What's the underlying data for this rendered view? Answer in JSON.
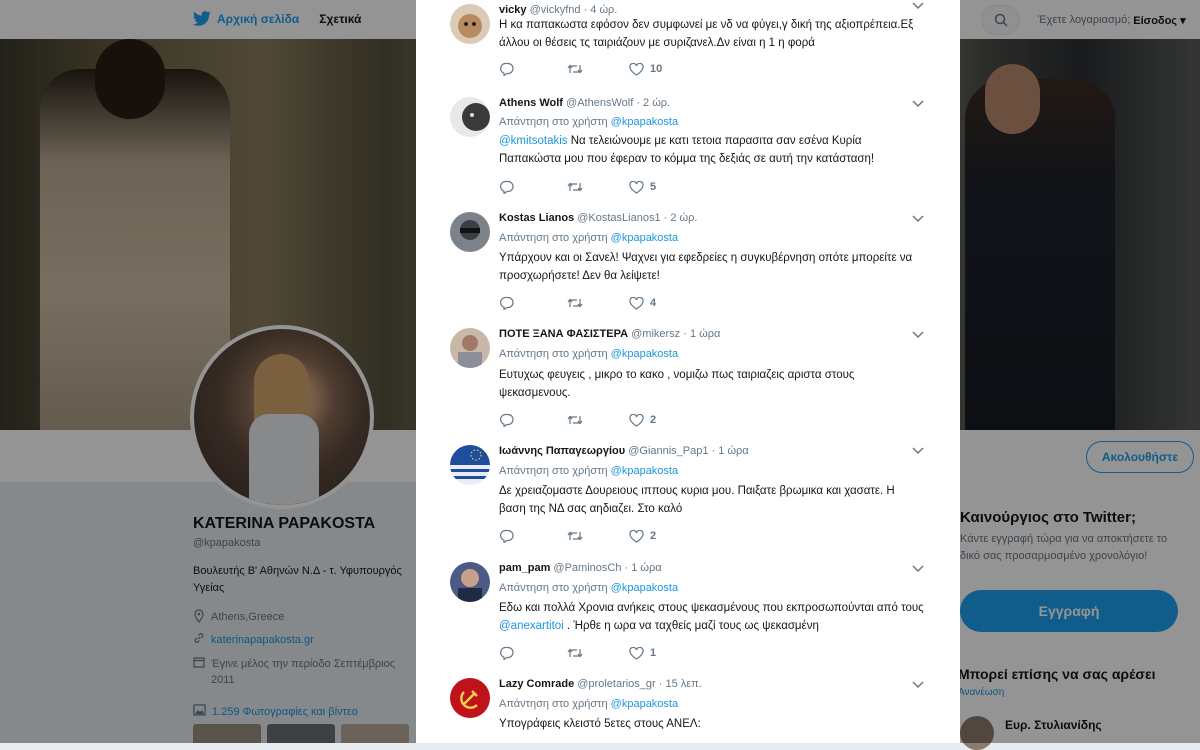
{
  "nav": {
    "home_label": "Αρχική σελίδα",
    "about_label": "Σχετικά",
    "account_text": "Έχετε λογαριασμό;",
    "login_label": "Είσοδος"
  },
  "profile": {
    "name": "KATERINA PAPAKOSTA",
    "handle": "@kpapakosta",
    "bio": "Βουλευτής Β' Αθηνών Ν.Δ - τ. Υφυπουργός Υγείας",
    "location": "Athens,Greece",
    "website": "katerinapapakosta.gr",
    "joined": "Έγινε μέλος την περίοδο Σεπτέμβριος 2011",
    "media": "1.259 Φωτογραφίες και βίντεο",
    "follow_label": "Ακολουθήστε"
  },
  "signup": {
    "title": "Καινούργιος στο Twitter;",
    "text": "Κάντε εγγραφή τώρα για να αποκτήσετε το δικό σας προσαρμοσμένο χρονολόγιο!",
    "button": "Εγγραφή"
  },
  "suggestions": {
    "title": "Μπορεί επίσης να σας αρέσει",
    "refresh": "Ανανέωση",
    "first_name": "Ευρ. Στυλιανίδης"
  },
  "replies": [
    {
      "name": "vicky",
      "handle": "@vickyfnd",
      "time": "· 4 ώρ.",
      "reply_prefix": "",
      "reply_to": "",
      "text": "Η κα παπακωστα εφόσον δεν συμφωνεί  με νδ να φύγει,γ δική της αξιοπρέπεια.Εξ άλλου οι θέσεις τς ταιριάζουν με συριζανελ.Δν είναι η 1 η φορά",
      "text_mention": "",
      "text_after": "",
      "likes": "10",
      "avatar_color": "#b78a60"
    },
    {
      "name": "Athens Wolf",
      "handle": "@AthensWolf",
      "time": "· 2 ώρ.",
      "reply_prefix": "Απάντηση στο χρήστη",
      "reply_to": "@kpapakosta",
      "text": "",
      "text_mention": "@kmitsotakis",
      "text_after": " Να τελειώνουμε με κατι τετοια παρασιτα σαν εσένα Κυρία Παπακώστα μου που έφεραν το κόμμα της δεξιάς σε αυτή την κατάσταση!",
      "likes": "5",
      "avatar_color": "#3a3a3a"
    },
    {
      "name": "Kostas Lianos",
      "handle": "@KostasLianos1",
      "time": "· 2 ώρ.",
      "reply_prefix": "Απάντηση στο χρήστη",
      "reply_to": "@kpapakosta",
      "text": "Υπάρχουν και οι Σανελ! Ψαχνει για εφεδρείες η συγκυβέρνηση οπότε μπορείτε να προσχωρήσετε! Δεν θα λείψετε!",
      "text_mention": "",
      "text_after": "",
      "likes": "4",
      "avatar_color": "#5b6168"
    },
    {
      "name": "ΠΟΤΕ ΞΑΝΑ ΦΑΣΙΣΤΕΡΑ",
      "handle": "@mikersz",
      "time": "· 1 ώρα",
      "reply_prefix": "Απάντηση στο χρήστη",
      "reply_to": "@kpapakosta",
      "text": "Ευτυχως  φευγεις , μικρο το κακο , νομιζω πως ταιριαζεις αριστα στους ψεκασμενους.",
      "text_mention": "",
      "text_after": "",
      "likes": "2",
      "avatar_color": "#a07a66"
    },
    {
      "name": "Ιωάννης Παπαγεωργίου",
      "handle": "@Giannis_Pap1",
      "time": "· 1 ώρα",
      "reply_prefix": "Απάντηση στο χρήστη",
      "reply_to": "@kpapakosta",
      "text": "Δε χρειαζομαστε Δουρειους ιππους κυρια μου. Παιξατε βρωμικα και χασατε. Η βαση της ΝΔ σας αηδιαζει. Στο καλό",
      "text_mention": "",
      "text_after": "",
      "likes": "2",
      "avatar_color": "#1f4e9c"
    },
    {
      "name": "pam_pam",
      "handle": "@PaminosCh",
      "time": "· 1 ώρα",
      "reply_prefix": "Απάντηση στο χρήστη",
      "reply_to": "@kpapakosta",
      "text": "Εδω και πολλά Χρονια ανήκεις  στους ψεκασμένους που εκπροσωπούνται από τους ",
      "text_mention": "@anexartitoi",
      "text_after": " . Ήρθε η ωρα να ταχθείς μαζί τους ως ψεκασμένη",
      "likes": "1",
      "avatar_color": "#4a5c86"
    },
    {
      "name": "Lazy Comrade",
      "handle": "@proletarios_gr",
      "time": "· 15 λεπ.",
      "reply_prefix": "Απάντηση στο χρήστη",
      "reply_to": "@kpapakosta",
      "text": "Υπογράφεις κλειστό 5ετες στους ΑΝΕΛ:",
      "text_mention": "",
      "text_after": "",
      "likes": "",
      "avatar_color": "#c0121b"
    }
  ],
  "colors": {
    "accent": "#1da1f2",
    "link": "#1b95e0",
    "text": "#14171a",
    "muted": "#657786"
  }
}
